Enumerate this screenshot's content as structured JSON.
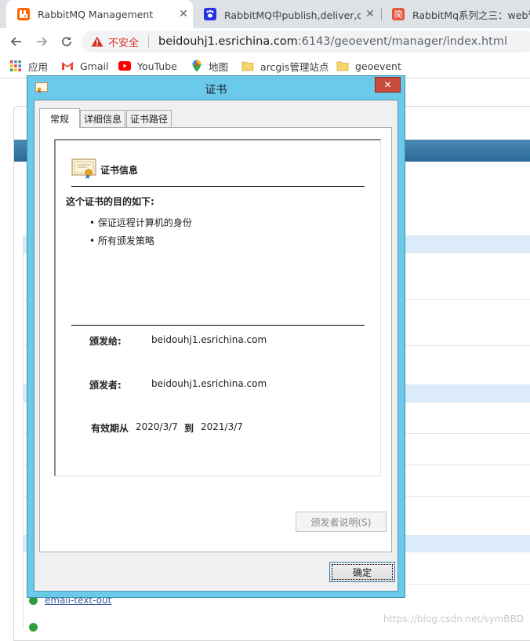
{
  "browser": {
    "tabs": [
      {
        "title": "RabbitMQ Management",
        "favicon": "rabbitmq-icon",
        "color": "#ff6600",
        "active": true
      },
      {
        "title": "RabbitMQ中publish,deliver,co",
        "favicon": "baidu-paw-icon",
        "color": "#2932e1",
        "active": false
      },
      {
        "title": "RabbitMq系列之三：web管理",
        "favicon": "jian-icon",
        "color": "#e8563f",
        "glyph": "简",
        "active": false
      }
    ],
    "security_label": "不安全",
    "url_host": "beidouhj1.esrichina.com",
    "url_rest": ":6143/geoevent/manager/index.html",
    "bookmarks": [
      {
        "label": "应用",
        "icon": "apps-grid-icon"
      },
      {
        "label": "Gmail",
        "icon": "gmail-icon"
      },
      {
        "label": "YouTube",
        "icon": "youtube-icon"
      },
      {
        "label": "地图",
        "icon": "maps-icon"
      },
      {
        "label": "arcgis管理站点",
        "icon": "folder-icon"
      },
      {
        "label": "geoevent",
        "icon": "folder-icon"
      }
    ]
  },
  "background_page": {
    "link_text": "email-text-out",
    "watermark": "https://blog.csdn.net/symBBD"
  },
  "dialog": {
    "title": "证书",
    "tabs": [
      "常规",
      "详细信息",
      "证书路径"
    ],
    "cert_info_heading": "证书信息",
    "purpose_title": "这个证书的目的如下:",
    "purposes": [
      "保证远程计算机的身份",
      "所有颁发策略"
    ],
    "issued_to_label": "颁发给:",
    "issued_to": "beidouhj1.esrichina.com",
    "issued_by_label": "颁发者:",
    "issued_by": "beidouhj1.esrichina.com",
    "valid_from_label": "有效期从",
    "valid_from": "2020/3/7",
    "valid_to_label": "到",
    "valid_to": "2021/3/7",
    "issuer_statement_button": "颁发者说明(S)",
    "ok_button": "确定"
  }
}
